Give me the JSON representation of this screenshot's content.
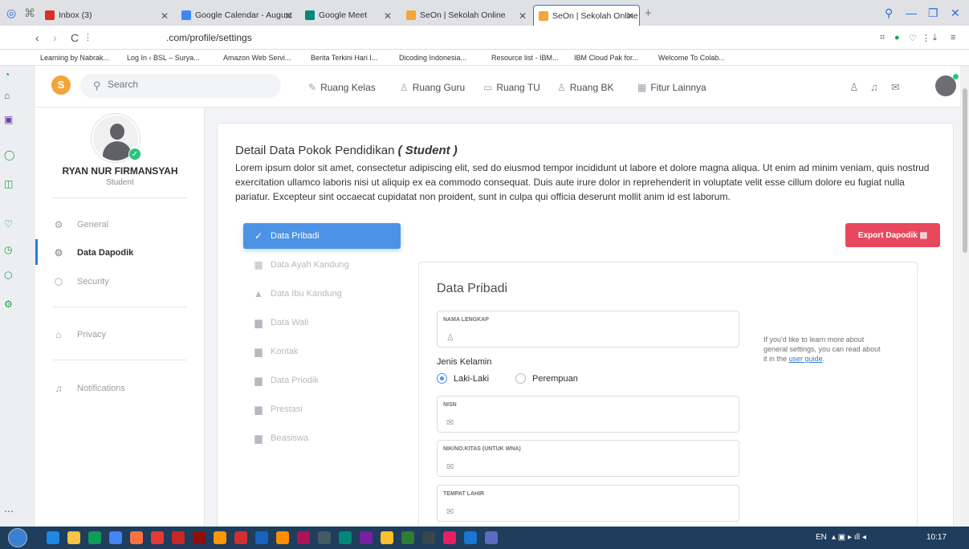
{
  "tabs": [
    {
      "label": "Inbox (3)",
      "color": "#d93025"
    },
    {
      "label": "Google Calendar - August",
      "color": "#4285f4"
    },
    {
      "label": "Google Meet",
      "color": "#00897b"
    },
    {
      "label": "SeOn | Sekolah Online",
      "color": "#f4a53a"
    },
    {
      "label": "SeOn | Sekolah Online",
      "color": "#f4a53a"
    }
  ],
  "browser": {
    "url": ".com/profile/settings",
    "bookmarks": [
      "Learning by Nabrak...",
      "Log In ‹ BSL – Surya...",
      "Amazon Web Servi...",
      "Berita Terkini Hari I...",
      "Dicoding Indonesia...",
      "Resource list - IBM...",
      "IBM Cloud Pak for...",
      "Welcome To Colab..."
    ]
  },
  "topnav": {
    "search_placeholder": "Search",
    "menu": [
      "Ruang Kelas",
      "Ruang Guru",
      "Ruang TU",
      "Ruang BK",
      "Fitur Lainnya"
    ]
  },
  "profile": {
    "name": "RYAN NUR FIRMANSYAH",
    "role": "Student",
    "menu": [
      "General",
      "Data Dapodik",
      "Security",
      "Privacy",
      "Notifications"
    ]
  },
  "detail": {
    "title": "Detail Data Pokok Pendidikan",
    "title_em": "( Student )",
    "description": "Lorem ipsum dolor sit amet, consectetur adipiscing elit, sed do eiusmod tempor incididunt ut labore et dolore magna aliqua. Ut enim ad minim veniam, quis nostrud exercitation ullamco laboris nisi ut aliquip ex ea commodo consequat. Duis aute irure dolor in reprehenderit in voluptate velit esse cillum dolore eu fugiat nulla pariatur. Excepteur sint occaecat cupidatat non proident, sunt in culpa qui officia deserunt mollit anim id est laborum.",
    "export_label": "Export Dapodik",
    "tabs": [
      "Data Pribadi",
      "Data Ayah Kandung",
      "Data Ibu Kandung",
      "Data Wali",
      "Kontak",
      "Data Priodik",
      "Prestasi",
      "Beasiswa"
    ]
  },
  "form": {
    "title": "Data Pribadi",
    "nama_label": "NAMA LENGKAP",
    "jk_label": "Jenis Kelamin",
    "jk_options": [
      "Laki-Laki",
      "Perempuan"
    ],
    "nisn_label": "NISN",
    "nik_label": "NIK/NO.KITAS (UNTUK WNA)",
    "tempat_label": "TEMPAT LAHIR",
    "help_text": "If you'd like to learn more about general settings, you can read about it in the",
    "help_link": "user guide",
    "help_end": "."
  },
  "taskbar": {
    "lang": "EN",
    "time": "10:17"
  },
  "colors": {
    "primary": "#4c93e6",
    "danger": "#e8485e",
    "success": "#2cc27b"
  }
}
